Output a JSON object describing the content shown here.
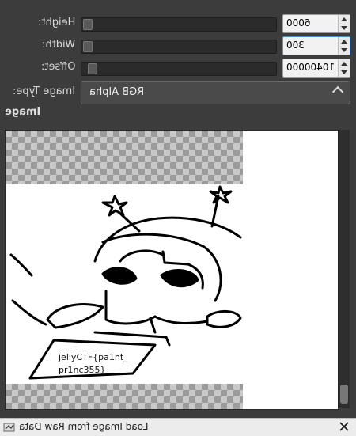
{
  "dialog": {
    "fields": [
      {
        "label": "Height:",
        "value": "6000"
      },
      {
        "label": "Width:",
        "value": "300"
      },
      {
        "label": "Offset:",
        "value": "10400000"
      }
    ],
    "image_type_label": "Image Type:",
    "image_type_value": "RGB Alpha",
    "section_title": "Image"
  },
  "preview": {
    "flag_line1": "jellyCTF{pa1nt_",
    "flag_line2": "pr1nc355}"
  },
  "window": {
    "title": "Load Image from Raw Data",
    "icons": [
      "app-icon",
      "close-icon"
    ]
  }
}
